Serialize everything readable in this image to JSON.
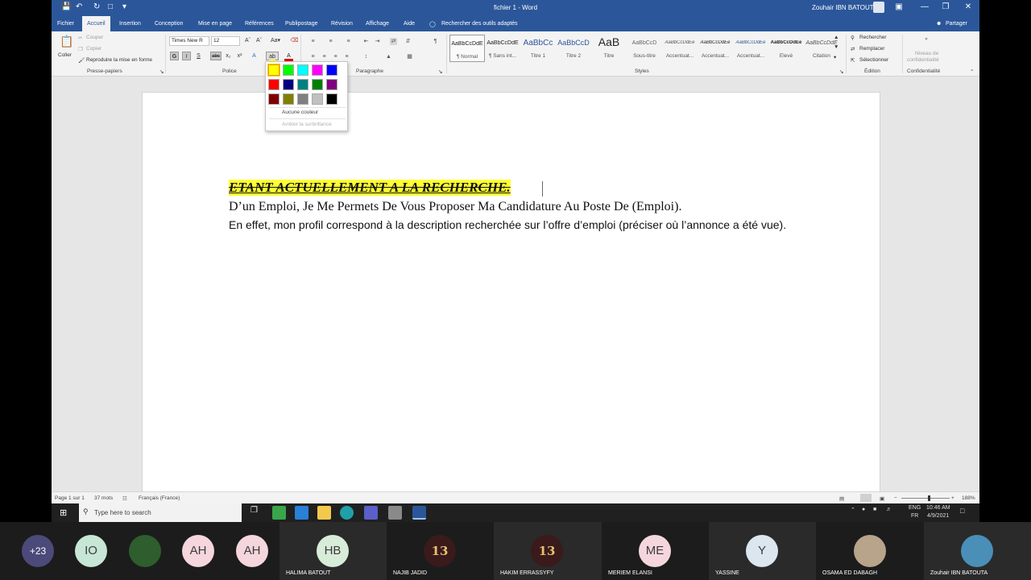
{
  "titlebar": {
    "title": "fichier 1  -  Word",
    "user": "Zouhair IBN BATOUTA",
    "share": "Partager",
    "tell_me": "Rechercher des outils adaptés"
  },
  "tabs": [
    "Fichier",
    "Accueil",
    "Insertion",
    "Conception",
    "Mise en page",
    "Références",
    "Publipostage",
    "Révision",
    "Affichage",
    "Aide"
  ],
  "ribbon": {
    "clipboard": {
      "paste": "Coller",
      "cut": "Couper",
      "copy": "Copier",
      "format_painter": "Reproduire la mise en forme",
      "label": "Presse-papiers"
    },
    "font": {
      "name": "Times New R",
      "size": "12",
      "label": "Police",
      "bold": "G",
      "italic": "I",
      "underline": "S",
      "strike": "abc"
    },
    "paragraph": {
      "label": "Paragraphe"
    },
    "styles": {
      "label": "Styles",
      "items": [
        {
          "preview": "AaBbCcDdE",
          "name": "¶ Normal"
        },
        {
          "preview": "AaBbCcDdE",
          "name": "¶ Sans int..."
        },
        {
          "preview": "AaBbCc",
          "name": "Titre 1"
        },
        {
          "preview": "AaBbCcD",
          "name": "Titre 2"
        },
        {
          "preview": "AaB",
          "name": "Titre"
        },
        {
          "preview": "AaBbCcD",
          "name": "Sous-titre"
        },
        {
          "preview": "AaBbCcDdEe",
          "name": "Accentuat..."
        },
        {
          "preview": "AaBbCcDdEe",
          "name": "Accentuat..."
        },
        {
          "preview": "AaBbCcDdEe",
          "name": "Accentuat..."
        },
        {
          "preview": "AaBbCcDdEe",
          "name": "Élevé"
        },
        {
          "preview": "AaBbCcDdE",
          "name": "Citation"
        }
      ]
    },
    "editing": {
      "find": "Rechercher",
      "replace": "Remplacer",
      "select": "Sélectionner",
      "label": "Édition"
    },
    "sensitivity": {
      "line1": "Niveau de",
      "line2": "confidentialité",
      "label": "Confidentialité"
    }
  },
  "highlight_menu": {
    "colors": [
      "#ffff00",
      "#00ff00",
      "#00ffff",
      "#ff00ff",
      "#0000ff",
      "#ff0000",
      "#000080",
      "#008080",
      "#008000",
      "#800080",
      "#800000",
      "#808000",
      "#808080",
      "#c0c0c0",
      "#000000"
    ],
    "no_color": "Aucune couleur",
    "stop": "Arrêter la surbrillance"
  },
  "document": {
    "heading": "ETANT ACTUELLEMENT A LA RECHERCHE.",
    "line1": "D’un Emploi, Je Me Permets De Vous Proposer Ma Candidature Au Poste De (Emploi).",
    "line2": "En effet, mon profil correspond à la description recherchée sur l’offre d’emploi (préciser où l’annonce a été vue)."
  },
  "status": {
    "page": "Page 1 sur 1",
    "words": "37 mots",
    "language": "Français (France)",
    "zoom": "188%"
  },
  "taskbar": {
    "search_placeholder": "Type here to search",
    "lang1": "ENG",
    "lang2": "FR",
    "time": "10:46 AM",
    "date": "4/9/2021"
  },
  "participants": [
    {
      "initials": "+23",
      "name": ""
    },
    {
      "initials": "IO",
      "name": ""
    },
    {
      "initials": "",
      "name": ""
    },
    {
      "initials": "AH",
      "name": ""
    },
    {
      "initials": "AH",
      "name": ""
    },
    {
      "initials": "HB",
      "name": "HALIMA BATOUT"
    },
    {
      "initials": "",
      "name": "NAJIB JADID"
    },
    {
      "initials": "",
      "name": "HAKIM ERRASSYFY"
    },
    {
      "initials": "ME",
      "name": "MERIEM ELANSI"
    },
    {
      "initials": "Y",
      "name": "YASSINE"
    },
    {
      "initials": "",
      "name": "OSAMA ED DABAGH"
    },
    {
      "initials": "",
      "name": "Zouhair IBN BATOUTA"
    }
  ],
  "participant_colors": {
    "counter": "#4b4a7a",
    "io": "#c7e6d6",
    "ah": "#f5d6dc",
    "hb": "#d7ecd9",
    "me": "#f5d6dc",
    "y": "#dbe6ee"
  }
}
